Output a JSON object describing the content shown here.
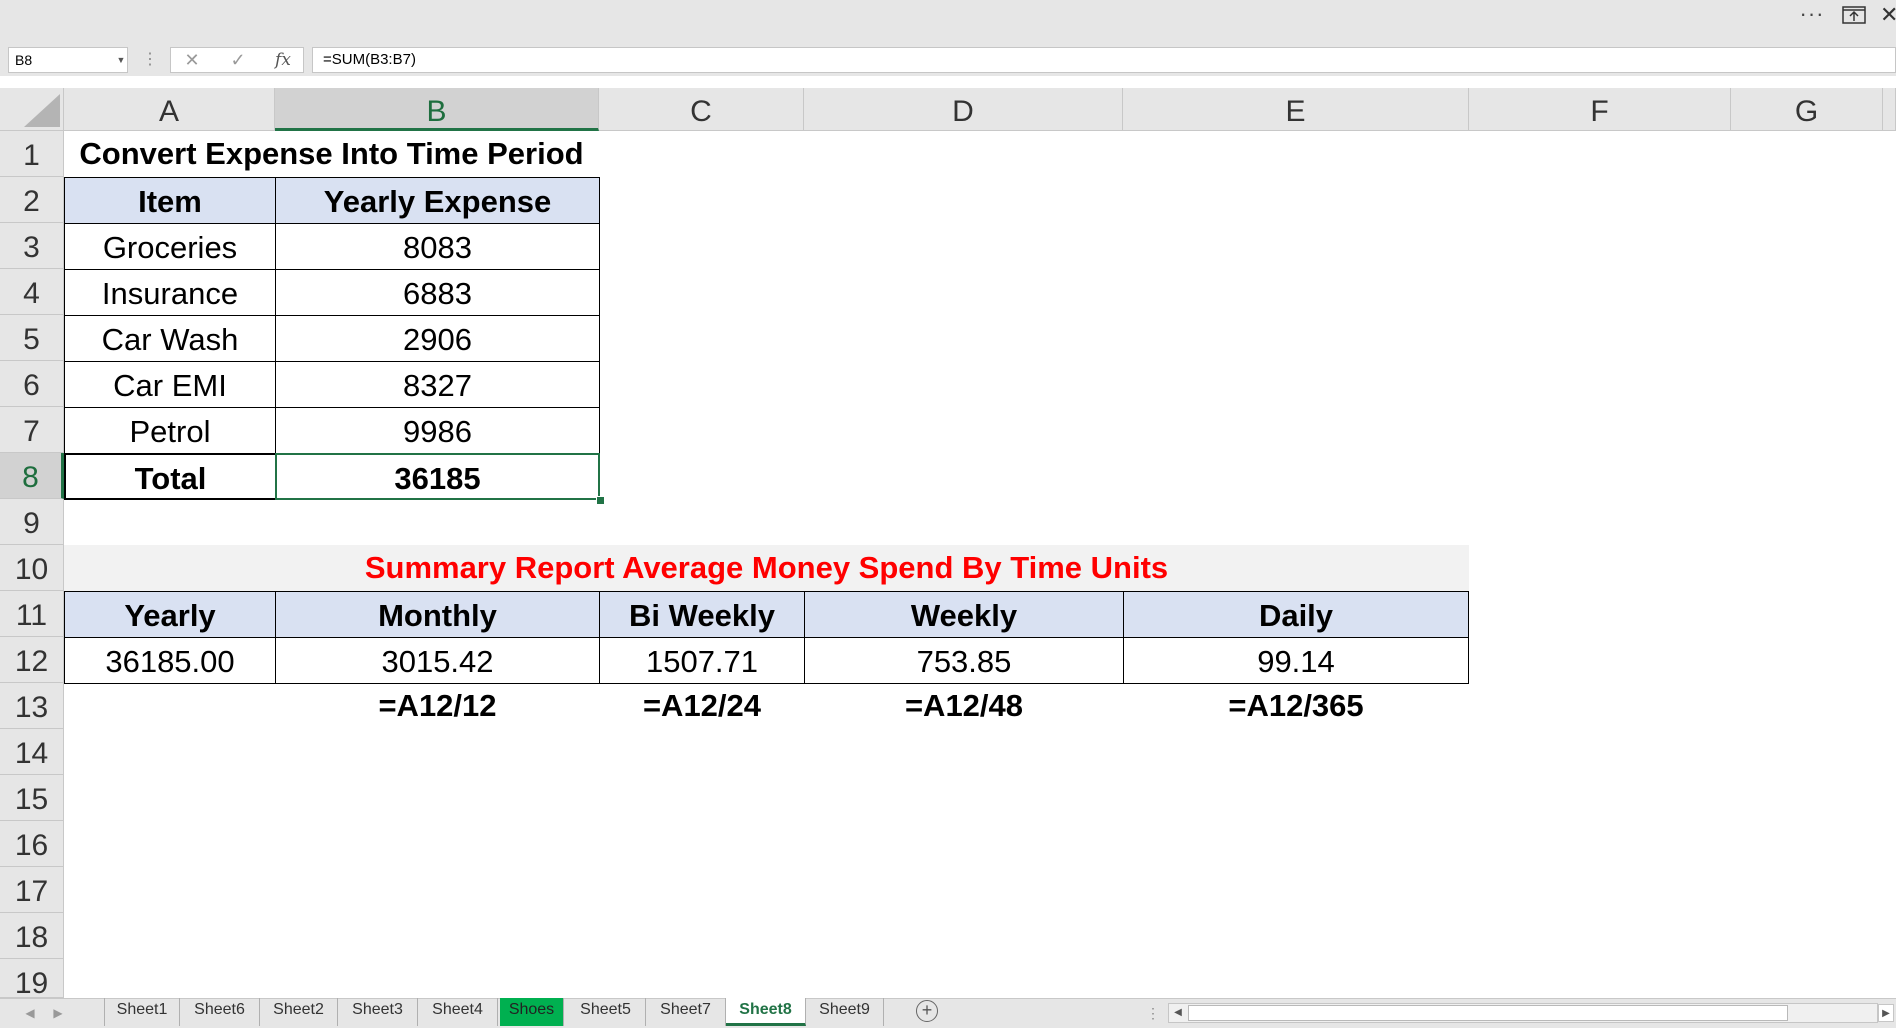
{
  "window": {
    "more_label": "···"
  },
  "formula_bar": {
    "name_box": "B8",
    "formula": "=SUM(B3:B7)"
  },
  "columns": [
    "A",
    "B",
    "C",
    "D",
    "E",
    "F",
    "G"
  ],
  "rows": [
    "1",
    "2",
    "3",
    "4",
    "5",
    "6",
    "7",
    "8",
    "9",
    "10",
    "11",
    "12",
    "13",
    "14",
    "15",
    "16",
    "17",
    "18",
    "19"
  ],
  "sheet": {
    "title": "Convert Expense Into Time Period",
    "expense_headers": {
      "item": "Item",
      "yearly": "Yearly Expense"
    },
    "expenses": [
      {
        "item": "Groceries",
        "value": "8083"
      },
      {
        "item": "Insurance",
        "value": "6883"
      },
      {
        "item": "Car Wash",
        "value": "2906"
      },
      {
        "item": "Car EMI",
        "value": "8327"
      },
      {
        "item": "Petrol",
        "value": "9986"
      }
    ],
    "total_label": "Total",
    "total_value": "36185",
    "summary_title": "Summary Report Average Money Spend By Time Units",
    "summary_headers": [
      "Yearly",
      "Monthly",
      "Bi Weekly",
      "Weekly",
      "Daily"
    ],
    "summary_values": [
      "36185.00",
      "3015.42",
      "1507.71",
      "753.85",
      "99.14"
    ],
    "summary_formulas": [
      "=A12/12",
      "=A12/24",
      "=A12/48",
      "=A12/365"
    ]
  },
  "colors": {
    "header_fill": "#d9e1f2",
    "title_red": "#ff0000",
    "summary_fill": "#f2f2f2",
    "accent": "#217346",
    "shoes_tab": "#00b050"
  },
  "tabs": [
    "Sheet1",
    "Sheet6",
    "Sheet2",
    "Sheet3",
    "Sheet4",
    "Shoes",
    "Sheet5",
    "Sheet7",
    "Sheet8",
    "Sheet9"
  ],
  "active_tab": "Sheet8"
}
